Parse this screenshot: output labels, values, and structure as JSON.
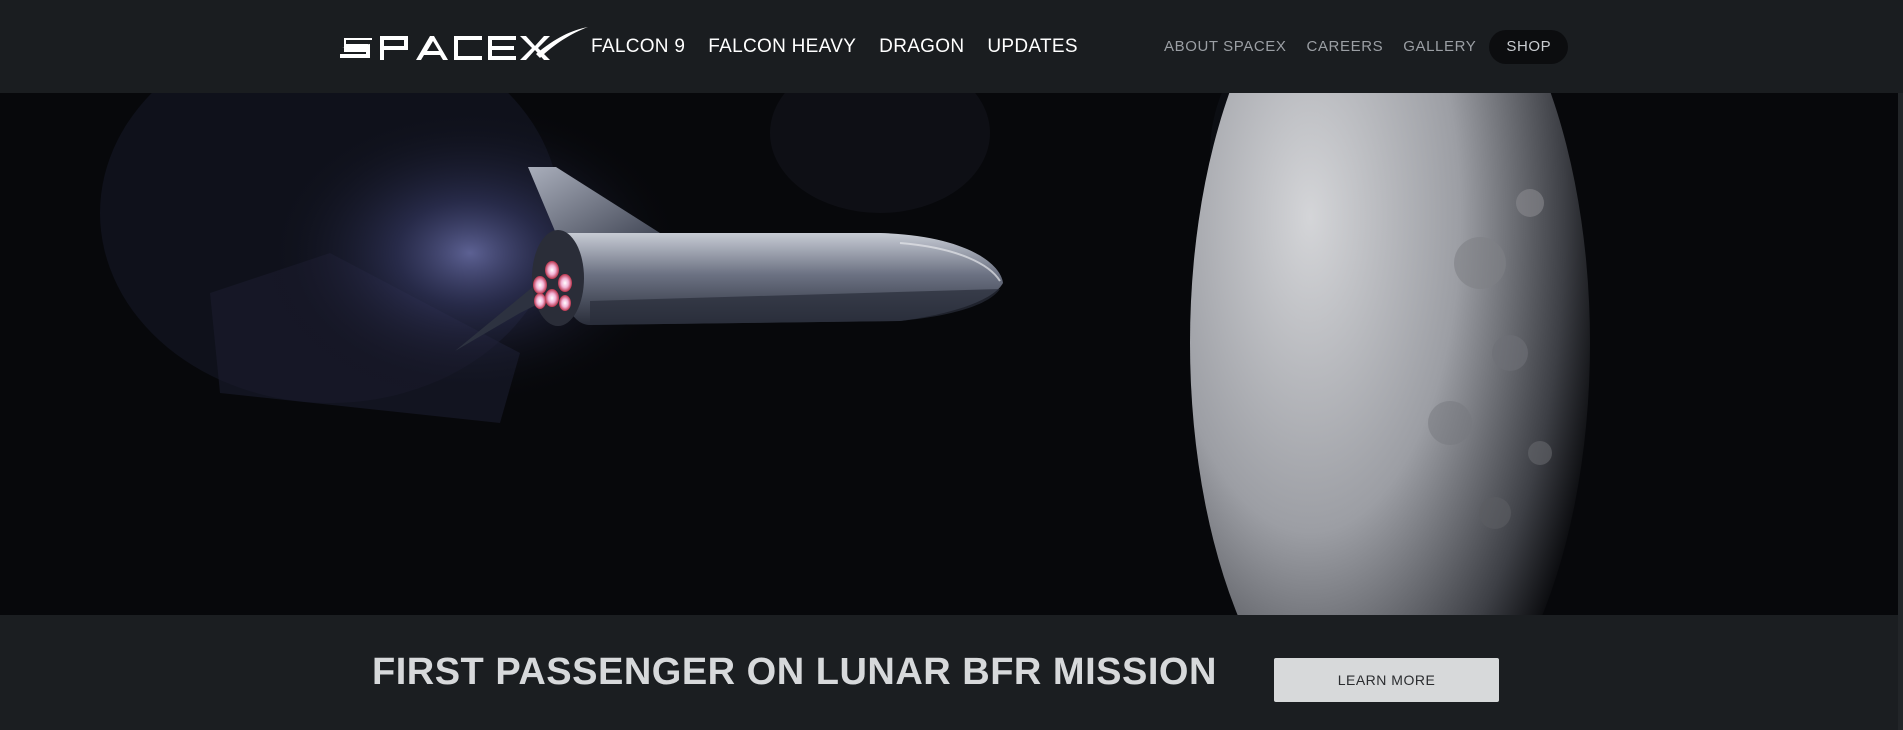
{
  "header": {
    "logo_text": "SPACEX",
    "primary_nav": [
      {
        "label": "FALCON 9"
      },
      {
        "label": "FALCON HEAVY"
      },
      {
        "label": "DRAGON"
      },
      {
        "label": "UPDATES"
      }
    ],
    "secondary_nav": [
      {
        "label": "ABOUT SPACEX"
      },
      {
        "label": "CAREERS"
      },
      {
        "label": "GALLERY"
      }
    ],
    "shop_label": "SHOP"
  },
  "hero": {
    "image_subject": "BFR spaceship in flight near the Moon"
  },
  "caption": {
    "title": "FIRST PASSENGER ON LUNAR BFR MISSION",
    "button_label": "LEARN MORE"
  },
  "colors": {
    "header_bg": "#1a1d20",
    "caption_bg": "#1b1e21",
    "button_bg": "#d7d9da",
    "nav_primary": "#ffffff",
    "nav_secondary": "#9b9fa4",
    "shop_bg": "#0c0d0f"
  }
}
